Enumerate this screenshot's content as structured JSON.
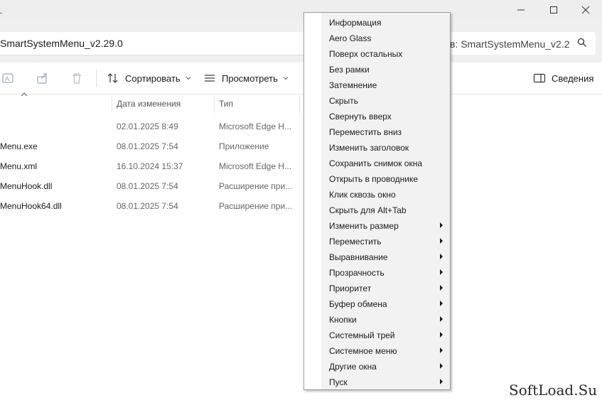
{
  "address": {
    "path": "SmartSystemMenu_v2.29.0"
  },
  "search": {
    "text": "в: SmartSystemMenu_v2.2"
  },
  "toolbar": {
    "sort_label": "Сортировать",
    "view_label": "Просмотреть",
    "details_label": "Сведения"
  },
  "columns": {
    "date": "Дата изменения",
    "type": "Тип"
  },
  "files": [
    {
      "name": "",
      "date": "02.01.2025 8:49",
      "type": "Microsoft Edge H..."
    },
    {
      "name": "Menu.exe",
      "date": "08.01.2025 7:54",
      "type": "Приложение"
    },
    {
      "name": "Menu.xml",
      "date": "16.10.2024 15:37",
      "type": "Microsoft Edge H..."
    },
    {
      "name": "MenuHook.dll",
      "date": "08.01.2025 7:54",
      "type": "Расширение при..."
    },
    {
      "name": "MenuHook64.dll",
      "date": "08.01.2025 7:54",
      "type": "Расширение при..."
    }
  ],
  "context_menu": {
    "items": [
      {
        "label": "Информация"
      },
      {
        "label": "Aero Glass"
      },
      {
        "label": "Поверх остальных"
      },
      {
        "label": "Без рамки"
      },
      {
        "label": "Затемнение"
      },
      {
        "label": "Скрыть"
      },
      {
        "label": "Свернуть вверх"
      },
      {
        "label": "Переместить вниз"
      },
      {
        "label": "Изменить заголовок"
      },
      {
        "label": "Сохранить снимок окна"
      },
      {
        "label": "Открыть в проводнике"
      },
      {
        "label": "Клик сквозь окно"
      },
      {
        "label": "Скрыть для Alt+Tab"
      },
      {
        "label": "Изменить размер"
      },
      {
        "label": "Переместить"
      },
      {
        "label": "Выравнивание"
      },
      {
        "label": "Прозрачность"
      },
      {
        "label": "Приоритет"
      },
      {
        "label": "Буфер обмена"
      },
      {
        "label": "Кнопки"
      },
      {
        "label": "Системный трей"
      },
      {
        "label": "Системное меню"
      },
      {
        "label": "Другие окна"
      },
      {
        "label": "Пуск"
      }
    ]
  },
  "watermark": {
    "text": "SoftLoad.Su"
  },
  "colors": {
    "titlebar": "#eeeeee",
    "menu_bg": "#f2f2f2",
    "menu_border": "#9a9a9a"
  }
}
